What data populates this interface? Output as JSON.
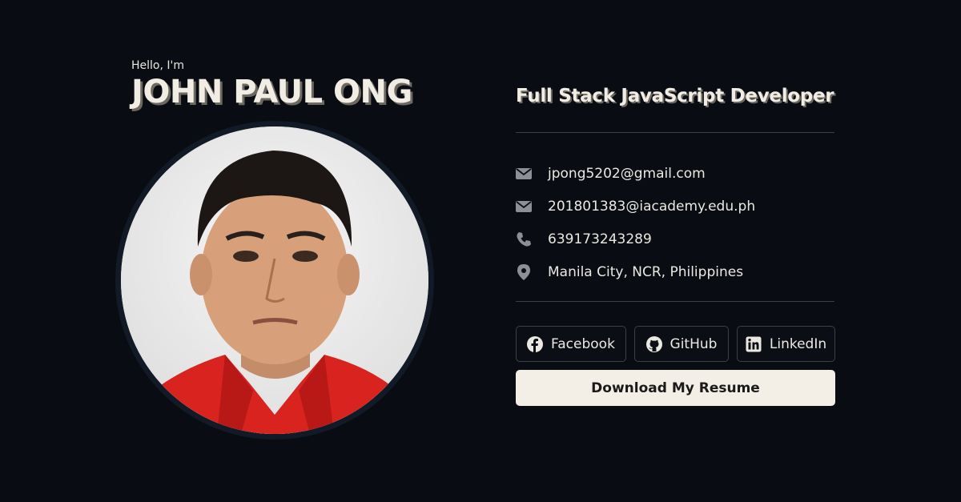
{
  "hero": {
    "greeting": "Hello, I'm",
    "name": "JOHN PAUL ONG",
    "role": "Full Stack JavaScript Developer"
  },
  "contacts": [
    {
      "icon": "envelope-icon",
      "text": "jpong5202@gmail.com"
    },
    {
      "icon": "envelope-icon",
      "text": "201801383@iacademy.edu.ph"
    },
    {
      "icon": "phone-icon",
      "text": "639173243289"
    },
    {
      "icon": "location-pin-icon",
      "text": "Manila City, NCR, Philippines"
    }
  ],
  "social": {
    "facebook": {
      "icon": "facebook-icon",
      "label": "Facebook"
    },
    "github": {
      "icon": "github-icon",
      "label": "GitHub"
    },
    "linkedin": {
      "icon": "linkedin-icon",
      "label": "LinkedIn"
    }
  },
  "resume_button": "Download My Resume",
  "colors": {
    "background": "#090d13",
    "text": "#f1ede4",
    "button_bg": "#f3eee6",
    "border": "#3c4047"
  }
}
